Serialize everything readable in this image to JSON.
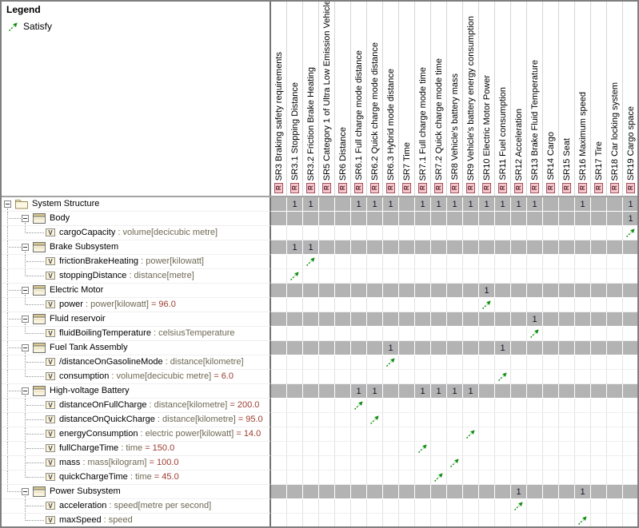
{
  "legend": {
    "title": "Legend",
    "items": [
      {
        "icon": "satisfy-arrow",
        "label": "Satisfy"
      }
    ]
  },
  "icons": {
    "requirement_badge_letter": "R",
    "value_badge_letter": "V",
    "satisfy": "green-dashed-diagonal-arrow",
    "package": "folder",
    "block": "block-rectangle"
  },
  "colors": {
    "satisfy_green": "#0e8c0e",
    "gray_cell": "#b3b3b3",
    "requirement_badge_bg": "#f7c5cc",
    "requirement_badge_border": "#a2525e",
    "type_text": "#6e6854",
    "value_text": "#9c3b2e"
  },
  "columns": [
    {
      "id": "SR3",
      "label": "SR3 Braking safety requirements"
    },
    {
      "id": "SR3.1",
      "label": "SR3.1 Stopping Distance"
    },
    {
      "id": "SR3.2",
      "label": "SR3.2 Friction Brake Heating"
    },
    {
      "id": "SR5",
      "label": "SR5 Category 1 of Ultra Low Emission Vehicle"
    },
    {
      "id": "SR6",
      "label": "SR6 Distance"
    },
    {
      "id": "SR6.1",
      "label": "SR6.1 Full charge mode distance"
    },
    {
      "id": "SR6.2",
      "label": "SR6.2 Quick charge mode distance"
    },
    {
      "id": "SR6.3",
      "label": "SR6.3 Hybrid mode distance"
    },
    {
      "id": "SR7",
      "label": "SR7 Time"
    },
    {
      "id": "SR7.1",
      "label": "SR7.1 Full charge mode time"
    },
    {
      "id": "SR7.2",
      "label": "SR7.2 Quick charge mode time"
    },
    {
      "id": "SR8",
      "label": "SR8 Vehicle's battery mass"
    },
    {
      "id": "SR9",
      "label": "SR9 Vehicle's battery energy consumption"
    },
    {
      "id": "SR10",
      "label": "SR10 Electric Motor Power"
    },
    {
      "id": "SR11",
      "label": "SR11 Fuel consumption"
    },
    {
      "id": "SR12",
      "label": "SR12 Acceleration"
    },
    {
      "id": "SR13",
      "label": "SR13 Brake Fluid Temperature"
    },
    {
      "id": "SR14",
      "label": "SR14 Cargo"
    },
    {
      "id": "SR15",
      "label": "SR15 Seat"
    },
    {
      "id": "SR16",
      "label": "SR16 Maximum speed"
    },
    {
      "id": "SR17",
      "label": "SR17 Tire"
    },
    {
      "id": "SR18",
      "label": "SR18 Car locking system"
    },
    {
      "id": "SR19",
      "label": "SR19 Cargo space"
    }
  ],
  "rows": [
    {
      "label": "System Structure",
      "kind": "package",
      "level": 0,
      "marks": {
        "SR3.1": "1",
        "SR3.2": "1",
        "SR6.1": "1",
        "SR6.2": "1",
        "SR6.3": "1",
        "SR7.1": "1",
        "SR7.2": "1",
        "SR8": "1",
        "SR9": "1",
        "SR10": "1",
        "SR11": "1",
        "SR12": "1",
        "SR13": "1",
        "SR16": "1",
        "SR19": "1"
      }
    },
    {
      "label": "Body",
      "kind": "block",
      "level": 1,
      "marks": {
        "SR19": "1"
      }
    },
    {
      "label": "cargoCapacity",
      "vtype": "volume[decicubic metre]",
      "kind": "value",
      "level": 2,
      "marks": {
        "SR19": "satisfy"
      }
    },
    {
      "label": "Brake Subsystem",
      "kind": "block",
      "level": 1,
      "marks": {
        "SR3.1": "1",
        "SR3.2": "1"
      }
    },
    {
      "label": "frictionBrakeHeating",
      "vtype": "power[kilowatt]",
      "kind": "value",
      "level": 2,
      "marks": {
        "SR3.2": "satisfy"
      }
    },
    {
      "label": "stoppingDistance",
      "vtype": "distance[metre]",
      "kind": "value",
      "level": 2,
      "marks": {
        "SR3.1": "satisfy"
      }
    },
    {
      "label": "Electric Motor",
      "kind": "block",
      "level": 1,
      "marks": {
        "SR10": "1"
      }
    },
    {
      "label": "power",
      "vtype": "power[kilowatt]",
      "value": "96.0",
      "kind": "value",
      "level": 2,
      "marks": {
        "SR10": "satisfy"
      }
    },
    {
      "label": "Fluid reservoir",
      "kind": "block",
      "level": 1,
      "marks": {
        "SR13": "1"
      }
    },
    {
      "label": "fluidBoilingTemperature",
      "vtype": "celsiusTemperature",
      "kind": "value",
      "level": 2,
      "marks": {
        "SR13": "satisfy"
      }
    },
    {
      "label": "Fuel Tank Assembly",
      "kind": "block",
      "level": 1,
      "marks": {
        "SR6.3": "1",
        "SR11": "1"
      }
    },
    {
      "label": "/distanceOnGasolineMode",
      "vtype": "distance[kilometre]",
      "kind": "value",
      "level": 2,
      "marks": {
        "SR6.3": "satisfy"
      }
    },
    {
      "label": "consumption",
      "vtype": "volume[decicubic metre]",
      "value": "6.0",
      "kind": "value",
      "level": 2,
      "marks": {
        "SR11": "satisfy"
      }
    },
    {
      "label": "High-voltage Battery",
      "kind": "block",
      "level": 1,
      "marks": {
        "SR6.1": "1",
        "SR6.2": "1",
        "SR7.1": "1",
        "SR7.2": "1",
        "SR8": "1",
        "SR9": "1"
      }
    },
    {
      "label": "distanceOnFullCharge",
      "vtype": "distance[kilometre]",
      "value": "200.0",
      "kind": "value",
      "level": 2,
      "marks": {
        "SR6.1": "satisfy"
      }
    },
    {
      "label": "distanceOnQuickCharge",
      "vtype": "distance[kilometre]",
      "value": "95.0",
      "kind": "value",
      "level": 2,
      "marks": {
        "SR6.2": "satisfy"
      }
    },
    {
      "label": "energyConsumption",
      "vtype": "electric power[kilowatt]",
      "value": "14.0",
      "kind": "value",
      "level": 2,
      "marks": {
        "SR9": "satisfy"
      }
    },
    {
      "label": "fullChargeTime",
      "vtype": "time",
      "value": "150.0",
      "kind": "value",
      "level": 2,
      "marks": {
        "SR7.1": "satisfy"
      }
    },
    {
      "label": "mass",
      "vtype": "mass[kilogram]",
      "value": "100.0",
      "kind": "value",
      "level": 2,
      "marks": {
        "SR8": "satisfy"
      }
    },
    {
      "label": "quickChargeTime",
      "vtype": "time",
      "value": "45.0",
      "kind": "value",
      "level": 2,
      "marks": {
        "SR7.2": "satisfy"
      }
    },
    {
      "label": "Power Subsystem",
      "kind": "block",
      "level": 1,
      "marks": {
        "SR12": "1",
        "SR16": "1"
      }
    },
    {
      "label": "acceleration",
      "vtype": "speed[metre per second]",
      "kind": "value",
      "level": 2,
      "marks": {
        "SR12": "satisfy"
      }
    },
    {
      "label": "maxSpeed",
      "vtype": "speed",
      "kind": "value",
      "level": 2,
      "marks": {
        "SR16": "satisfy"
      }
    }
  ],
  "text": {
    "type_separator": " : ",
    "value_separator": " = "
  }
}
